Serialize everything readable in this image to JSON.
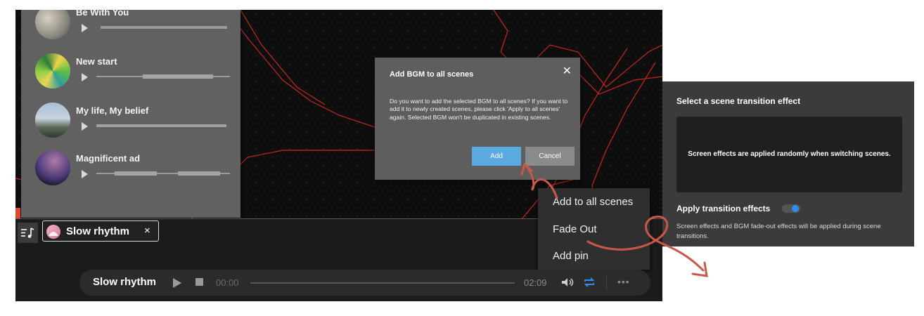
{
  "music_list": [
    {
      "title": "Be With You",
      "thumb": "thumb-desert"
    },
    {
      "title": "New start",
      "thumb": "thumb-abstract-green"
    },
    {
      "title": "My life, My belief",
      "thumb": "thumb-person-outdoors"
    },
    {
      "title": "Magnificent ad",
      "thumb": "thumb-starry-sky"
    }
  ],
  "dialog": {
    "title": "Add BGM to all scenes",
    "message": "Do you want to add the selected BGM to all scenes? If you want to add it to newly created scenes, please click 'Apply to all scenes' again. Selected BGM won't be duplicated in existing scenes.",
    "add_label": "Add",
    "cancel_label": "Cancel",
    "close_glyph": "✕"
  },
  "bgm_chip": {
    "label": "Slow rhythm",
    "close_glyph": "×"
  },
  "context_menu": {
    "items": [
      "Add to all scenes",
      "Fade Out",
      "Add pin"
    ]
  },
  "player": {
    "title": "Slow rhythm",
    "time_current": "00:00",
    "time_total": "02:09",
    "more_glyph": "•••",
    "progress": 0
  },
  "transition_panel": {
    "title": "Select a scene transition effect",
    "effect_text": "Screen effects are applied randomly when switching scenes.",
    "apply_label": "Apply transition effects",
    "apply_enabled": true,
    "apply_description": "Screen effects and BGM fade-out effects will be applied during scene transitions."
  },
  "colors": {
    "accent_blue": "#2a8ef0",
    "annotation_red": "#c8584a",
    "canvas_red_lines": "#c8281e"
  }
}
